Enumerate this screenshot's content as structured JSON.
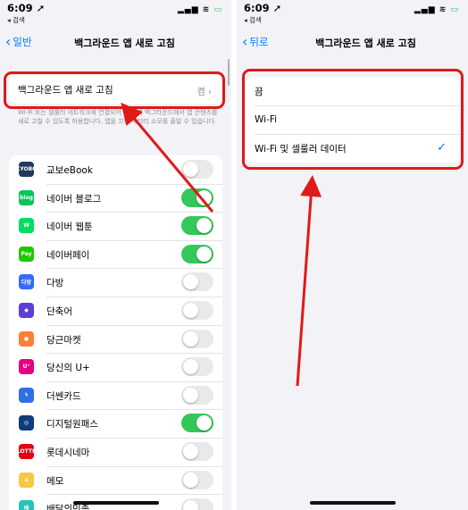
{
  "left": {
    "status": {
      "time": "6:09 ➚",
      "back_label": "◂ 검색",
      "icons": "▂▄▆ ≋"
    },
    "nav": {
      "back_label": "일반",
      "title": "백그라운드 앱 새로 고침"
    },
    "setting": {
      "label": "백그라운드 앱 새로 고침",
      "value": "켬 ›"
    },
    "footnote": "Wi-Fi 또는 셀룰러 네트워크에 연결되어 있을 때 백그라운드에서 앱 콘텐츠를 새로 고칠 수 있도록 허용합니다. 앱을 끄면 배터리 소모를 줄일 수 있습니다.",
    "apps": [
      {
        "name": "교보eBook",
        "icon": "kyobo-ebook-icon",
        "color": "#1f3a5f",
        "glyph": "KYOBO",
        "on": false
      },
      {
        "name": "네이버 블로그",
        "icon": "naver-blog-icon",
        "color": "#03c75a",
        "glyph": "blog",
        "on": true
      },
      {
        "name": "네이버 웹툰",
        "icon": "naver-webtoon-icon",
        "color": "#00dc64",
        "glyph": "W",
        "on": true
      },
      {
        "name": "네이버페이",
        "icon": "naver-pay-icon",
        "color": "#1ec800",
        "glyph": "Pay",
        "on": true
      },
      {
        "name": "다방",
        "icon": "dabang-icon",
        "color": "#326cf9",
        "glyph": "다방",
        "on": false
      },
      {
        "name": "단축어",
        "icon": "shortcuts-icon",
        "color": "#5b3fd6",
        "glyph": "◆",
        "on": false
      },
      {
        "name": "당근마켓",
        "icon": "daangn-icon",
        "color": "#ff7e36",
        "glyph": "●",
        "on": false
      },
      {
        "name": "당신의 U+",
        "icon": "uplus-icon",
        "color": "#e6007e",
        "glyph": "U⁺",
        "on": false
      },
      {
        "name": "더쎈카드",
        "icon": "thessen-card-icon",
        "color": "#2f6ee8",
        "glyph": "ϟ",
        "on": false
      },
      {
        "name": "디지털원패스",
        "icon": "digital-onepass-icon",
        "color": "#0f3c7a",
        "glyph": "◎",
        "on": true
      },
      {
        "name": "롯데시네마",
        "icon": "lotte-cinema-icon",
        "color": "#e50012",
        "glyph": "LOTTE",
        "on": false
      },
      {
        "name": "메모",
        "icon": "notes-icon",
        "color": "#f7c843",
        "glyph": "≡",
        "on": false
      },
      {
        "name": "배달의민족",
        "icon": "baemin-icon",
        "color": "#2ac1bc",
        "glyph": "배",
        "on": false
      }
    ]
  },
  "right": {
    "status": {
      "time": "6:09 ➚",
      "back_label": "◂ 검색",
      "icons": "▂▄▆ ≋"
    },
    "nav": {
      "back_label": "뒤로",
      "title": "백그라운드 앱 새로 고침"
    },
    "options": [
      {
        "label": "끔",
        "selected": false
      },
      {
        "label": "Wi-Fi",
        "selected": false
      },
      {
        "label": "Wi-Fi 및 셀룰러 데이터",
        "selected": true
      }
    ],
    "check_glyph": "✓"
  },
  "annotation": {
    "color": "#e01919"
  }
}
